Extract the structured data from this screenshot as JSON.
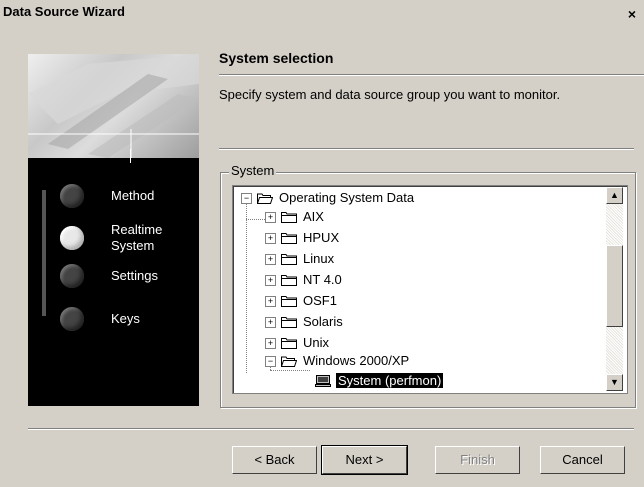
{
  "window": {
    "title": "Data Source Wizard",
    "close": "×"
  },
  "steps": [
    {
      "label": "Method",
      "active": false
    },
    {
      "label": "Realtime\nSystem",
      "active": true
    },
    {
      "label": "Settings",
      "active": false
    },
    {
      "label": "Keys",
      "active": false
    }
  ],
  "header": {
    "title": "System selection",
    "description": "Specify system and data source group you want to monitor."
  },
  "group": {
    "label": "System"
  },
  "tree": {
    "root": "Operating System Data",
    "items": [
      "AIX",
      "HPUX",
      "Linux",
      "NT 4.0",
      "OSF1",
      "Solaris",
      "Unix",
      "Windows 2000/XP"
    ],
    "selected_child": "System (perfmon)"
  },
  "buttons": {
    "back": "< Back",
    "next": "Next >",
    "finish": "Finish",
    "cancel": "Cancel"
  }
}
